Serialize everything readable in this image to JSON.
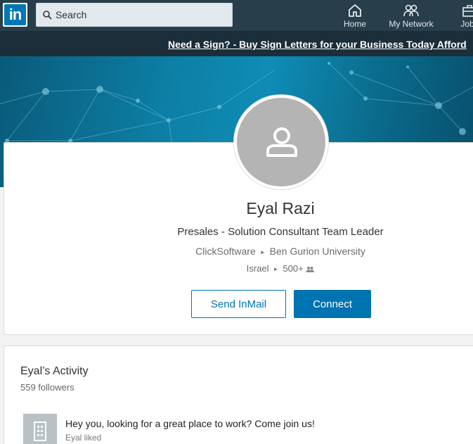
{
  "nav": {
    "logo": "in",
    "search_placeholder": "Search",
    "items": [
      {
        "label": "Home",
        "icon": "home-icon"
      },
      {
        "label": "My Network",
        "icon": "network-icon"
      },
      {
        "label": "Jobs",
        "icon": "briefcase-icon"
      }
    ]
  },
  "ad": {
    "text": "Need a Sign? - Buy Sign Letters for your Business Today Afford"
  },
  "profile": {
    "name": "Eyal Razi",
    "headline": "Presales - Solution Consultant Team Leader",
    "company": "ClickSoftware",
    "school": "Ben Gurion University",
    "location": "Israel",
    "connections": "500+",
    "send_inmail_label": "Send InMail",
    "connect_label": "Connect"
  },
  "activity": {
    "title": "Eyal’s Activity",
    "followers": "559 followers",
    "posts": [
      {
        "text": "Hey you, looking for a great place to work? Come join us!",
        "sub": "Eyal liked"
      }
    ]
  },
  "colors": {
    "nav_bg": "#283e4a",
    "accent": "#0073b1",
    "hero": "#0d7fa5"
  }
}
